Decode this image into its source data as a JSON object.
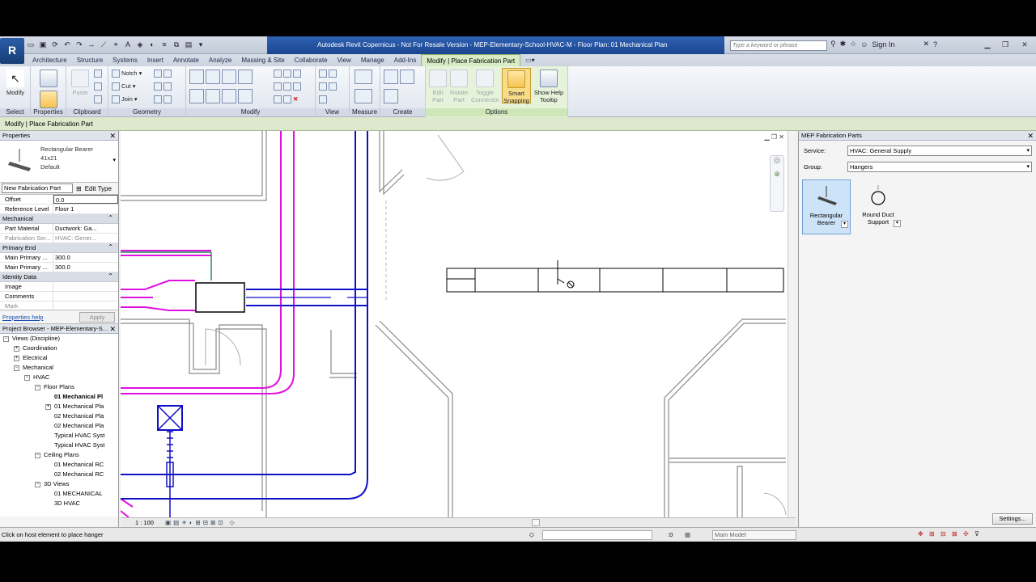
{
  "titlebar": {
    "title": "Autodesk Revit Copernicus - Not For Resale Version  -  MEP-Elementary-School-HVAC-M - Floor Plan: 01 Mechanical Plan",
    "search_placeholder": "Type a keyword or phrase",
    "sign_in": "Sign In"
  },
  "tabs": [
    "Architecture",
    "Structure",
    "Systems",
    "Insert",
    "Annotate",
    "Analyze",
    "Massing & Site",
    "Collaborate",
    "View",
    "Manage",
    "Add-Ins",
    "Modify | Place Fabrication Part"
  ],
  "ribbon": {
    "select": {
      "modify": "Modify",
      "label": "Select"
    },
    "properties": {
      "label": "Properties"
    },
    "clipboard": {
      "paste": "Paste",
      "label": "Clipboard"
    },
    "geometry": {
      "notch": "Notch",
      "cut": "Cut",
      "join": "Join",
      "label": "Geometry"
    },
    "modify": {
      "label": "Modify"
    },
    "view": {
      "label": "View"
    },
    "measure": {
      "label": "Measure"
    },
    "create": {
      "label": "Create"
    },
    "options": {
      "edit_part": "Edit Part",
      "rotate_part": "Rotate Part",
      "toggle_connector": "Toggle Connector",
      "smart_snapping": "Smart Snapping",
      "show_help_tooltip": "Show Help Tooltip",
      "label": "Options"
    }
  },
  "optbar": {
    "text": "Modify | Place Fabrication Part"
  },
  "properties": {
    "title": "Properties",
    "type_line1": "Rectangular Bearer",
    "type_line2": "41x21",
    "type_line3": "Default",
    "filter": "New Fabrication Part",
    "edit_type": "Edit Type",
    "rows_top": [
      {
        "k": "Offset",
        "v": "0.0"
      },
      {
        "k": "Reference Level",
        "v": "Floor 1"
      }
    ],
    "group_mechanical": "Mechanical",
    "rows_mech": [
      {
        "k": "Part Material",
        "v": "Ductwork: Ga..."
      },
      {
        "k": "Fabrication Ser...",
        "v": "HVAC: Gener..."
      }
    ],
    "group_primary": "Primary End",
    "rows_primary": [
      {
        "k": "Main Primary ...",
        "v": "300.0"
      },
      {
        "k": "Main Primary ...",
        "v": "300.0"
      }
    ],
    "group_identity": "Identity Data",
    "rows_identity": [
      {
        "k": "Image",
        "v": ""
      },
      {
        "k": "Comments",
        "v": ""
      },
      {
        "k": "Mark",
        "v": ""
      }
    ],
    "help": "Properties help",
    "apply": "Apply"
  },
  "browser": {
    "title": "Project Browser - MEP-Elementary-S...",
    "nodes": [
      {
        "label": "Views (Discipline)",
        "level": 0,
        "toggle": "−"
      },
      {
        "label": "Coordination",
        "level": 1,
        "toggle": "+"
      },
      {
        "label": "Electrical",
        "level": 1,
        "toggle": "+"
      },
      {
        "label": "Mechanical",
        "level": 1,
        "toggle": "−"
      },
      {
        "label": "HVAC",
        "level": 2,
        "toggle": "−"
      },
      {
        "label": "Floor Plans",
        "level": 3,
        "toggle": "−"
      },
      {
        "label": "01 Mechanical Pl",
        "level": 4,
        "toggle": "",
        "bold": true
      },
      {
        "label": "01 Mechanical Pla",
        "level": 4,
        "toggle": "+"
      },
      {
        "label": "02 Mechanical Pla",
        "level": 4,
        "toggle": ""
      },
      {
        "label": "02 Mechanical Pla",
        "level": 4,
        "toggle": ""
      },
      {
        "label": "Typical HVAC Syst",
        "level": 4,
        "toggle": ""
      },
      {
        "label": "Typical HVAC Syst",
        "level": 4,
        "toggle": ""
      },
      {
        "label": "Ceiling Plans",
        "level": 3,
        "toggle": "−"
      },
      {
        "label": "01 Mechanical RC",
        "level": 4,
        "toggle": ""
      },
      {
        "label": "02 Mechanical RC",
        "level": 4,
        "toggle": ""
      },
      {
        "label": "3D Views",
        "level": 3,
        "toggle": "−"
      },
      {
        "label": "01 MECHANICAL",
        "level": 4,
        "toggle": ""
      },
      {
        "label": "3D HVAC",
        "level": 4,
        "toggle": ""
      }
    ]
  },
  "viewbar": {
    "scale": "1 : 100"
  },
  "fab_parts": {
    "title": "MEP Fabrication Parts",
    "service_label": "Service:",
    "service_value": "HVAC: General Supply",
    "group_label": "Group:",
    "group_value": "Hangers",
    "parts": [
      {
        "label1": "Rectangular",
        "label2": "Bearer"
      },
      {
        "label1": "Round Duct",
        "label2": "Support"
      }
    ],
    "settings": "Settings..."
  },
  "status": {
    "message": "Click on host element to place hanger",
    "zero": ":0",
    "model": "Main Model"
  },
  "colors": {
    "duct_supply": "#1010c8",
    "duct_return": "#e010e0",
    "pipe_green": "#2a8a5a",
    "wall": "#8a8a8a",
    "ribbon_accent": "#d7ecc4"
  }
}
